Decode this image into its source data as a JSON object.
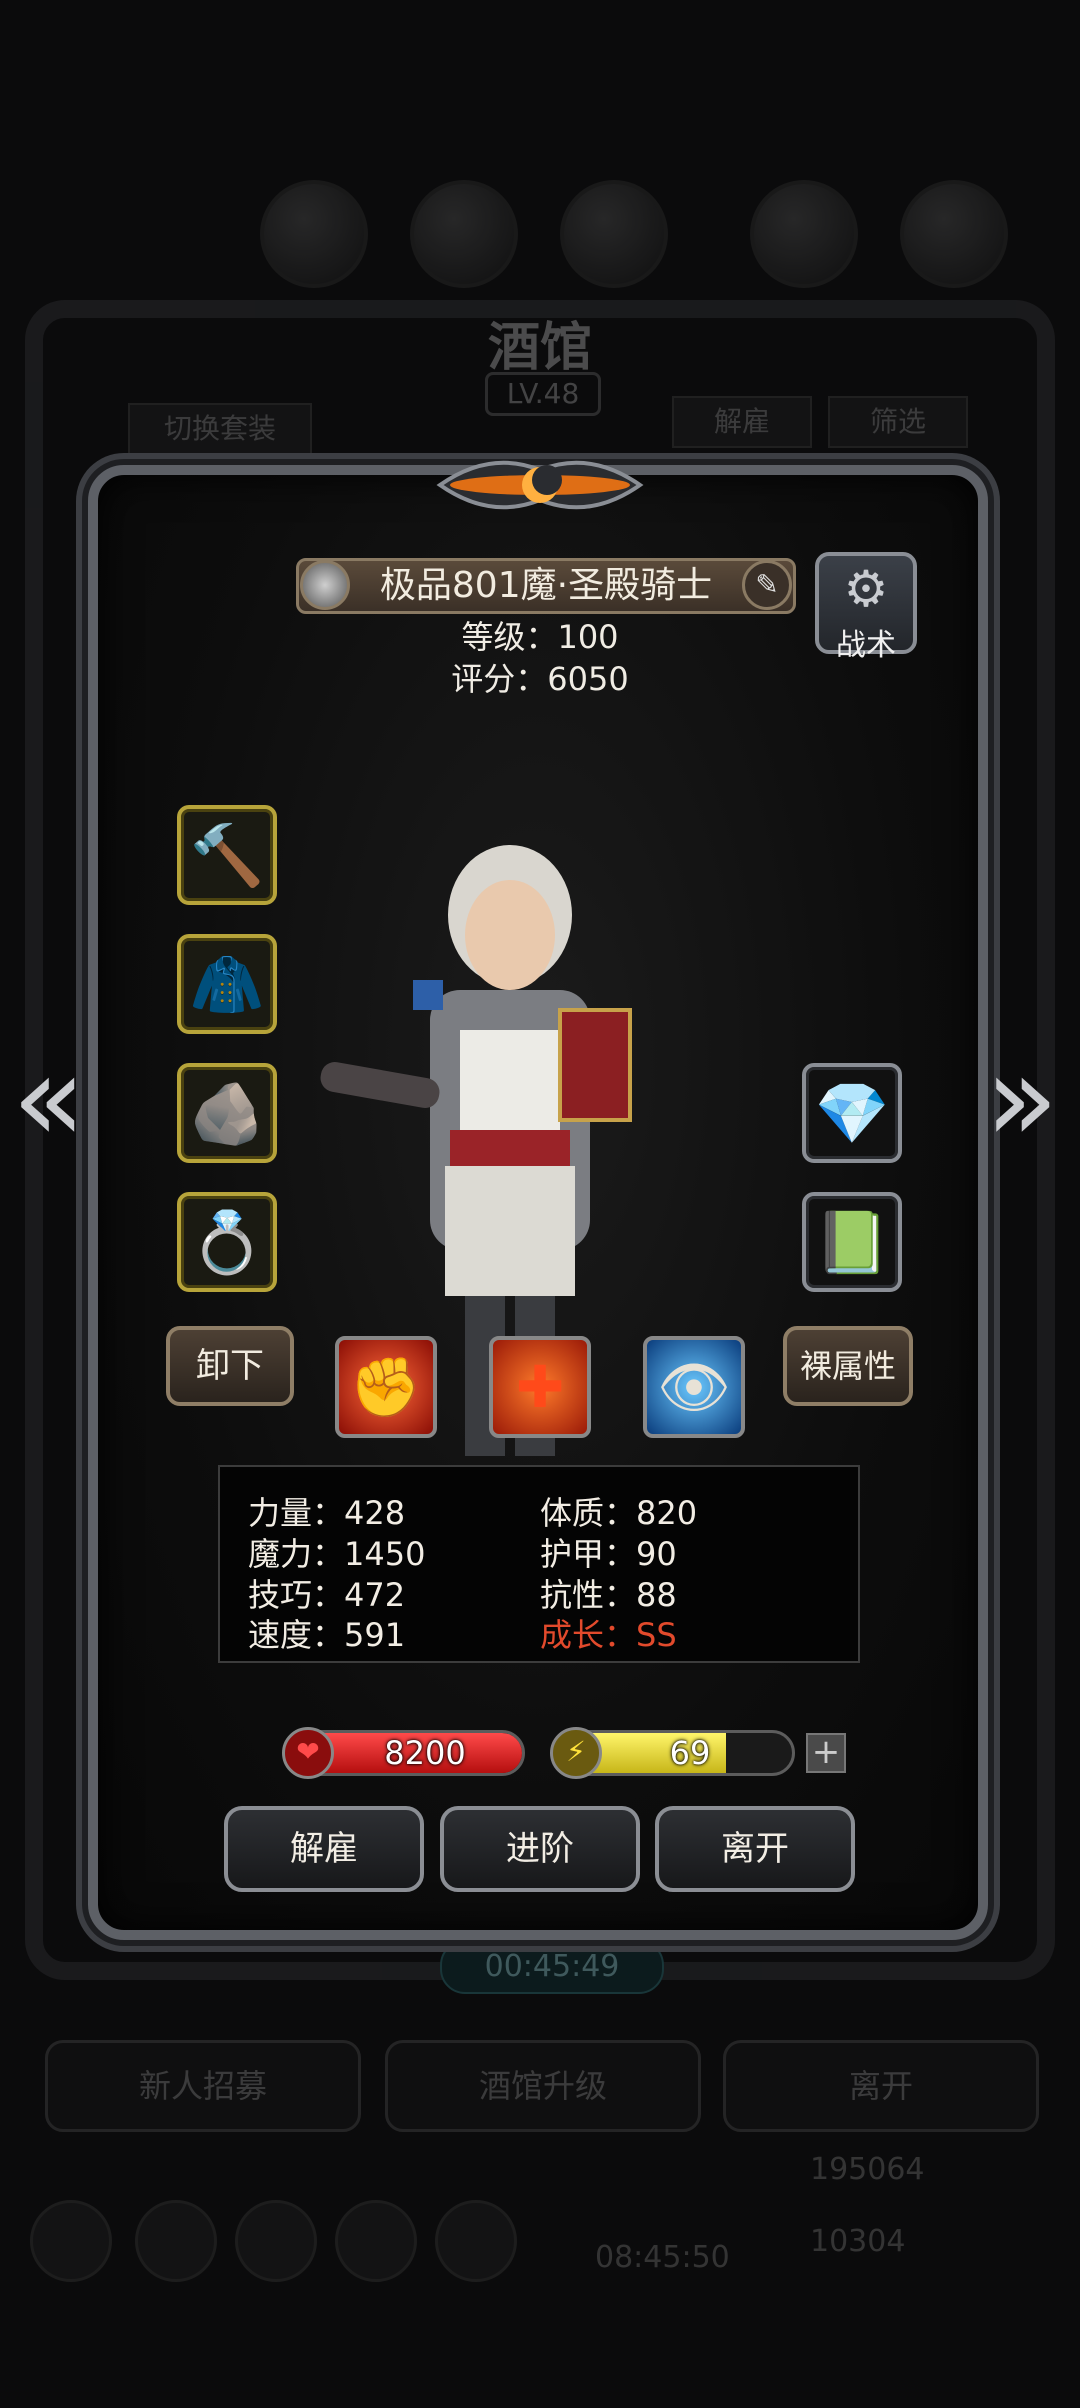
{
  "background": {
    "title": "酒馆",
    "level": "LV.48",
    "switch_outfit": "切换套装",
    "dismiss": "解雇",
    "filter": "筛选",
    "timer": "00:45:49",
    "buttons": [
      "新人招募",
      "酒馆升级",
      "离开"
    ],
    "bottom_timer": "08:45:50",
    "gold": "195064",
    "gems": "10304"
  },
  "hero": {
    "name": "极品801魔·圣殿骑士",
    "level_line": "等级：100",
    "score_line": "评分：6050"
  },
  "tactics_label": "战术",
  "equipment_left": [
    {
      "icon": "hammer-icon",
      "glyph": "🔨"
    },
    {
      "icon": "cloak-icon",
      "glyph": "🧥"
    },
    {
      "icon": "rune-stone-icon",
      "glyph": "🪨"
    },
    {
      "icon": "ring-icon",
      "glyph": "💍"
    }
  ],
  "equipment_right": [
    {
      "icon": "green-gem-icon",
      "glyph": "💎"
    },
    {
      "icon": "green-card-icon",
      "glyph": "📗"
    }
  ],
  "unequip_label": "卸下",
  "base_attr_label": "裸属性",
  "skills": [
    {
      "icon": "fist-skill-icon",
      "glyph": "✊",
      "bg": "#b21a0a"
    },
    {
      "icon": "heal-cross-skill-icon",
      "glyph": "✚",
      "bg": "#c0320f"
    },
    {
      "icon": "eye-skill-icon",
      "glyph": "👁",
      "bg": "#1260b0"
    }
  ],
  "stats": {
    "strength": "力量：428",
    "magic": "魔力：1450",
    "skill": "技巧：472",
    "speed": "速度：591",
    "constitution": "体质：820",
    "armor": "护甲：90",
    "resistance": "抗性：88",
    "growth": "成长：SS"
  },
  "hp": {
    "value": "8200",
    "fill": 1.0
  },
  "energy": {
    "value": "69",
    "fill": 0.72
  },
  "actions": {
    "dismiss": "解雇",
    "advance": "进阶",
    "leave": "离开"
  },
  "colors": {
    "growth": "#e24a2c",
    "hp": "#d01a1a",
    "energy": "#e6d83a"
  }
}
